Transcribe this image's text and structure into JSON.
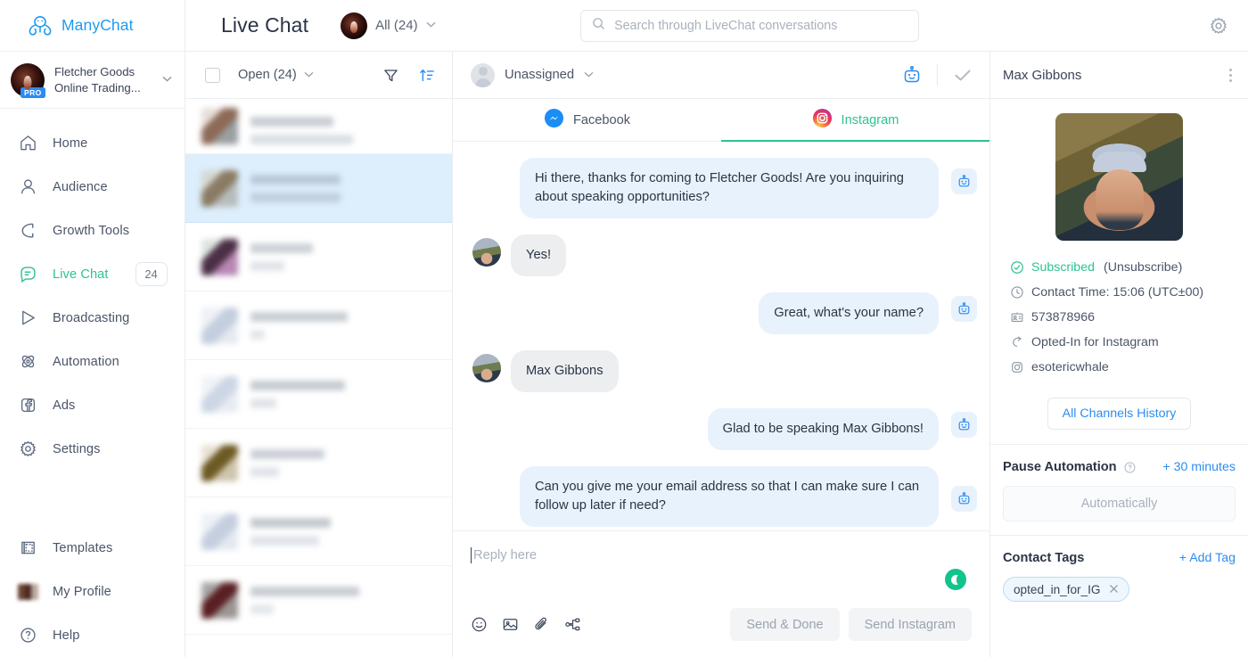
{
  "brand": {
    "name": "ManyChat",
    "logo_icon": "octopus-logo-icon",
    "color": "#1e9bf0"
  },
  "account": {
    "line1": "Fletcher Goods",
    "line2": "Online Trading...",
    "badge": "PRO",
    "caret_icon": "chevron-down-icon"
  },
  "sidebar": {
    "items": [
      {
        "label": "Home",
        "icon": "home-icon",
        "active": false
      },
      {
        "label": "Audience",
        "icon": "user-icon",
        "active": false
      },
      {
        "label": "Growth Tools",
        "icon": "magnet-icon",
        "active": false
      },
      {
        "label": "Live Chat",
        "icon": "chat-bubble-icon",
        "active": true,
        "badge": "24"
      },
      {
        "label": "Broadcasting",
        "icon": "send-icon",
        "active": false
      },
      {
        "label": "Automation",
        "icon": "atom-icon",
        "active": false
      },
      {
        "label": "Ads",
        "icon": "facebook-ads-icon",
        "active": false
      },
      {
        "label": "Settings",
        "icon": "gear-icon",
        "active": false
      }
    ],
    "bottom_items": [
      {
        "label": "Templates",
        "icon": "templates-icon"
      },
      {
        "label": "My Profile",
        "icon": "profile-thumbnail-icon"
      },
      {
        "label": "Help",
        "icon": "question-circle-icon"
      }
    ],
    "active_color": "#2dc48d"
  },
  "topbar": {
    "title": "Live Chat",
    "account_filter": {
      "label": "All (24)",
      "caret_icon": "chevron-down-icon"
    },
    "search": {
      "placeholder": "Search through LiveChat conversations",
      "value": "",
      "icon": "search-icon"
    },
    "settings_icon": "gear-icon"
  },
  "conversation_list": {
    "select_all_checkbox": {
      "checked": false,
      "icon": "checkbox-icon"
    },
    "status_filter": {
      "label": "Open (24)",
      "caret_icon": "chevron-down-icon"
    },
    "filter_icon": "filter-funnel-icon",
    "sort_icon": "sort-ascending-icon",
    "rows": [
      {
        "selected": false,
        "partial": true,
        "avatar": "#8d6a57",
        "title_w": "58%",
        "snippet_w": "72%",
        "meta_w": "62%"
      },
      {
        "selected": true,
        "partial": false,
        "avatar": "#8a7b63",
        "title_w": "63%",
        "snippet_w": "63%",
        "meta_w": "74%"
      },
      {
        "selected": false,
        "partial": false,
        "avatar": "#6d4b63",
        "title_w": "44%",
        "snippet_w": "24%",
        "meta_w": "50%"
      },
      {
        "selected": false,
        "partial": false,
        "avatar": "#b9c3d6",
        "title_w": "68%",
        "snippet_w": "54%",
        "meta_w": "46%"
      },
      {
        "selected": false,
        "partial": false,
        "avatar": "#c3cedf",
        "title_w": "66%",
        "snippet_w": "18%",
        "meta_w": "40%"
      },
      {
        "selected": false,
        "partial": false,
        "avatar": "#9a8456",
        "title_w": "52%",
        "snippet_w": "20%",
        "meta_w": "36%"
      },
      {
        "selected": false,
        "partial": false,
        "avatar": "#c2ccdd",
        "title_w": "56%",
        "snippet_w": "48%",
        "meta_w": "56%"
      },
      {
        "selected": false,
        "partial": false,
        "avatar": "#6d3238",
        "title_w": "76%",
        "snippet_w": "16%",
        "meta_w": "30%"
      }
    ]
  },
  "chat": {
    "assignee": {
      "label": "Unassigned",
      "avatar_icon": "user-avatar-icon",
      "caret_icon": "chevron-down-icon"
    },
    "bot_icon": "bot-robot-icon",
    "done_icon": "checkmark-icon",
    "tabs": [
      {
        "label": "Facebook",
        "icon": "messenger-icon",
        "active": false
      },
      {
        "label": "Instagram",
        "icon": "instagram-icon",
        "active": true
      }
    ],
    "messages": [
      {
        "from": "bot",
        "text": "Hi there, thanks for coming to Fletcher Goods! Are you inquiring about speaking opportunities?",
        "has_bot_tag": true,
        "wide": true
      },
      {
        "from": "user",
        "text": "Yes!",
        "has_avatar": true
      },
      {
        "from": "bot",
        "text": "Great, what's your name?",
        "has_bot_tag": true
      },
      {
        "from": "user",
        "text": "Max Gibbons",
        "has_avatar": true
      },
      {
        "from": "bot",
        "text": "Glad to be speaking Max Gibbons!",
        "has_bot_tag": true
      },
      {
        "from": "bot",
        "text": "Can you give me your email address so that I can make sure I can follow up later if need?",
        "has_bot_tag": true,
        "wide": true
      }
    ],
    "composer": {
      "placeholder": "Reply here",
      "value": "",
      "status_icon": "moon-status-icon",
      "icons": [
        "emoji-icon",
        "image-icon",
        "attachment-icon",
        "flow-icon"
      ],
      "buttons": [
        {
          "label": "Send & Done"
        },
        {
          "label": "Send Instagram"
        }
      ]
    }
  },
  "contact": {
    "name": "Max Gibbons",
    "kebab_icon": "more-options-icon",
    "avatar_icon": "contact-photo",
    "details": [
      {
        "icon": "check-circle-icon",
        "status": "Subscribed",
        "suffix": " (Unsubscribe)"
      },
      {
        "icon": "clock-icon",
        "text": "Contact Time:  15:06 (UTC±00)"
      },
      {
        "icon": "id-card-icon",
        "text": "573878966"
      },
      {
        "icon": "opt-in-icon",
        "text": "Opted-In for Instagram"
      },
      {
        "icon": "instagram-icon",
        "text": "esotericwhale"
      }
    ],
    "history_button": "All Channels History",
    "pause_automation": {
      "title": "Pause Automation",
      "help_icon": "question-circle-icon",
      "action": "+ 30 minutes",
      "field_value": "Automatically"
    },
    "contact_tags": {
      "title": "Contact Tags",
      "action": "+ Add Tag",
      "tags": [
        {
          "label": "opted_in_for_IG",
          "remove_icon": "close-icon"
        }
      ]
    }
  }
}
